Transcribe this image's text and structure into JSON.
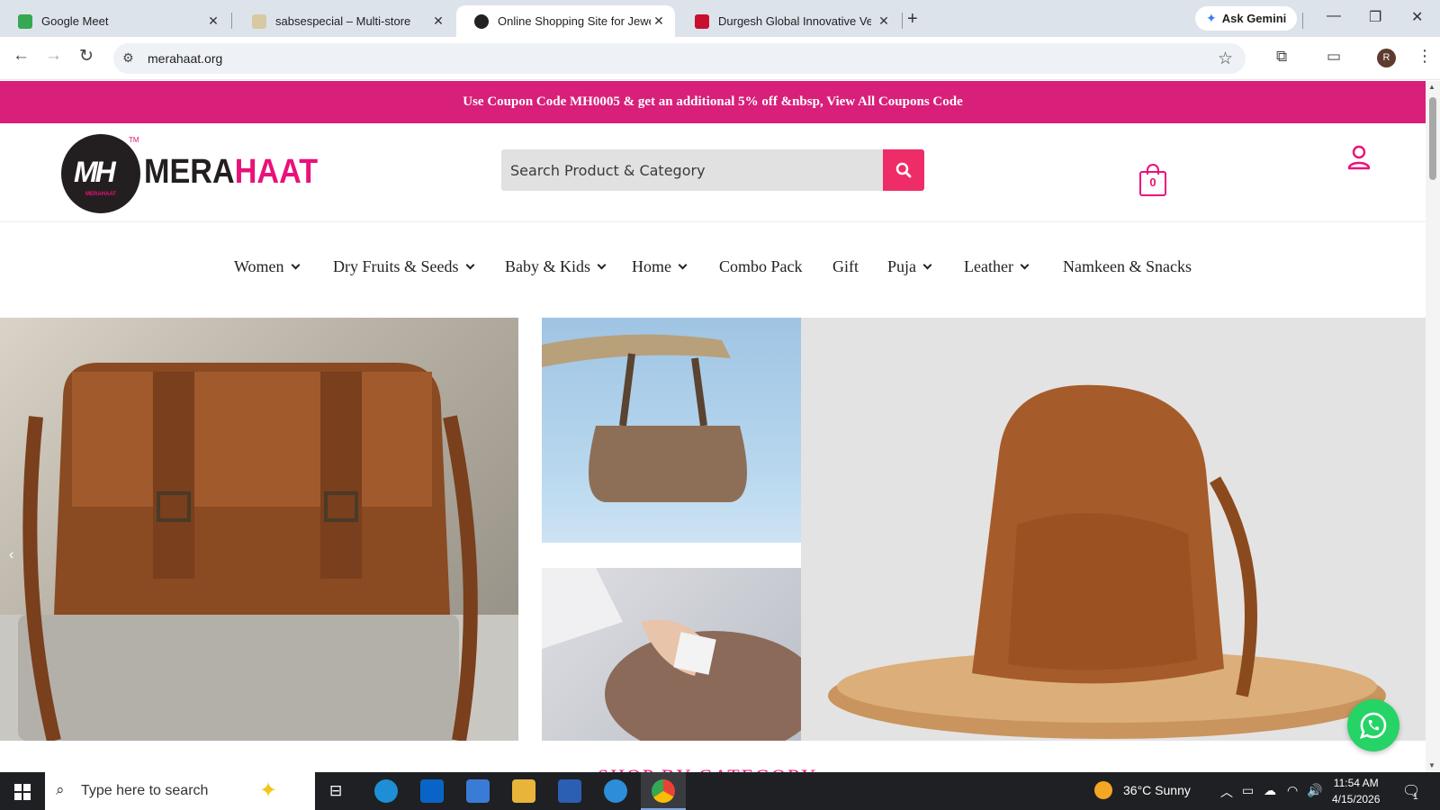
{
  "browser": {
    "tabs": [
      {
        "label": "Google Meet",
        "active": false
      },
      {
        "label": "sabsespecial – Multi-store",
        "active": false
      },
      {
        "label": "Online Shopping Site for Jewell",
        "active": true
      },
      {
        "label": "Durgesh Global Innovative Vent",
        "active": false
      }
    ],
    "new_tab": "+",
    "ask_gemini": "Ask Gemini",
    "url": "merahaat.org",
    "profile_initial": "R"
  },
  "site": {
    "coupon_text": "Use Coupon Code MH0005 & get an additional 5% off &nbsp, View All Coupons Code",
    "logo": {
      "mark": "MH",
      "mark_sub": "MERAHAAT",
      "tm": "TM",
      "word_a": "MERA",
      "word_b": "HAAT"
    },
    "search_placeholder": "Search Product & Category",
    "cart_count": "0",
    "menu": [
      {
        "label": "Women",
        "dropdown": true
      },
      {
        "label": "Dry Fruits & Seeds",
        "dropdown": true
      },
      {
        "label": "Baby & Kids",
        "dropdown": true
      },
      {
        "label": "Home",
        "dropdown": true
      },
      {
        "label": "Combo Pack",
        "dropdown": false
      },
      {
        "label": "Gift",
        "dropdown": false
      },
      {
        "label": "Puja",
        "dropdown": true
      },
      {
        "label": "Leather",
        "dropdown": true
      },
      {
        "label": "Namkeen & Snacks",
        "dropdown": false
      }
    ],
    "slider_prev": "‹",
    "section_heading": "SHOP BY CATEGORY",
    "accent_color": "#e9117b",
    "banner_color": "#d81f79"
  },
  "taskbar": {
    "search_placeholder": "Type here to search",
    "weather": "36°C  Sunny",
    "time": "11:54 AM",
    "date": "4/15/2026",
    "notification_count": "1"
  }
}
